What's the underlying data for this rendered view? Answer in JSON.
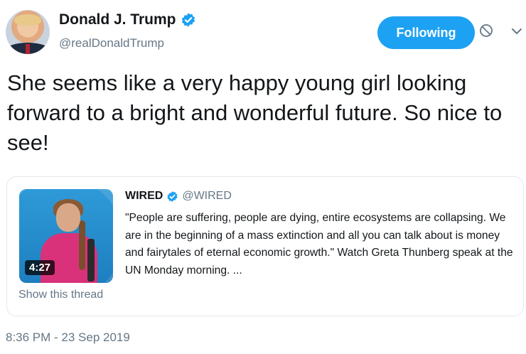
{
  "author": {
    "display_name": "Donald J. Trump",
    "handle": "@realDonaldTrump",
    "verified": true
  },
  "actions": {
    "follow_label": "Following",
    "block_icon": "block-icon",
    "more_icon": "chevron-down-icon"
  },
  "tweet": {
    "text": "She seems like a very happy young girl looking forward to a bright and wonderful future. So nice to see!",
    "timestamp": "8:36 PM - 23 Sep 2019"
  },
  "quoted_tweet": {
    "display_name": "WIRED",
    "handle": "@WIRED",
    "verified": true,
    "text": "\"People are suffering, people are dying, entire ecosystems are collapsing. We are in the beginning of a mass extinction and all you can talk about is money and fairytales of eternal economic growth.\" Watch Greta Thunberg speak at the UN Monday morning. ...",
    "video_duration": "4:27",
    "show_thread_label": "Show this thread"
  },
  "colors": {
    "accent": "#1da1f2",
    "secondary_text": "#657786",
    "border": "#e1e8ed"
  }
}
